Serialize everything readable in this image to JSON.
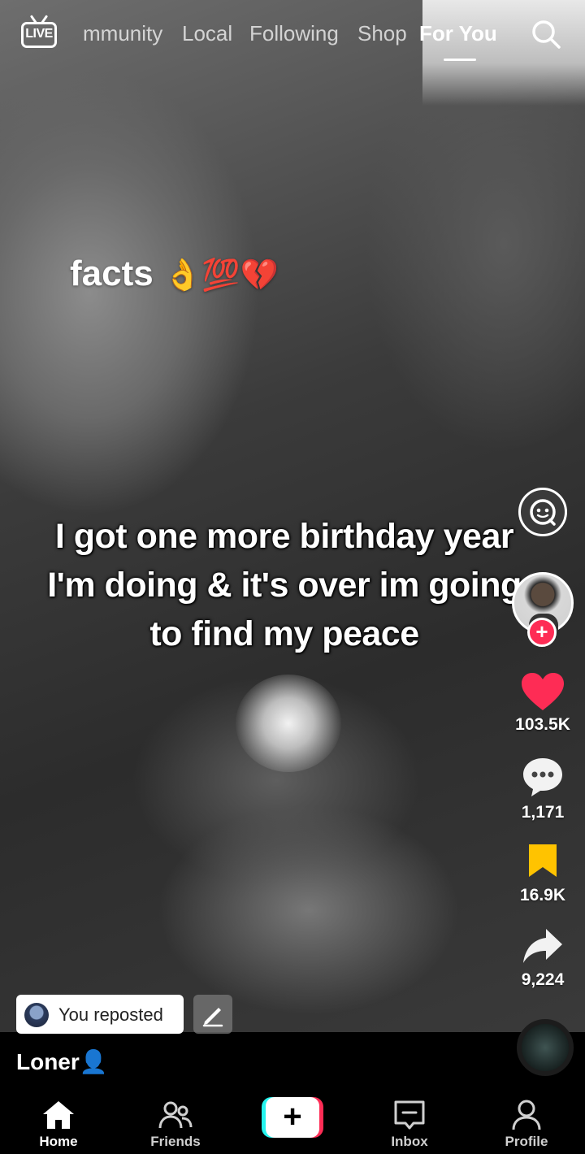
{
  "top_nav": {
    "live_label": "LIVE",
    "tabs": [
      {
        "label": "mmunity"
      },
      {
        "label": "Local"
      },
      {
        "label": "Following"
      },
      {
        "label": "Shop"
      },
      {
        "label": "For You"
      }
    ],
    "active_tab": "For You"
  },
  "video": {
    "overlay_text_top": "facts",
    "overlay_emojis": "👌💯💔",
    "overlay_caption": "I got one more birthday year I'm doing & it's over im going to find my peace"
  },
  "right_rail": {
    "likes": "103.5K",
    "comments": "1,171",
    "saves": "16.9K",
    "shares": "9,224",
    "follow_plus": "+"
  },
  "post": {
    "repost_label": "You reposted",
    "username": "Loner👤"
  },
  "bottom_nav": {
    "items": [
      {
        "label": "Home"
      },
      {
        "label": "Friends"
      },
      {
        "label": "+"
      },
      {
        "label": "Inbox"
      },
      {
        "label": "Profile"
      }
    ]
  },
  "colors": {
    "like_red": "#fe2c55",
    "save_yellow": "#ffc300",
    "accent_cyan": "#25f4ee"
  }
}
